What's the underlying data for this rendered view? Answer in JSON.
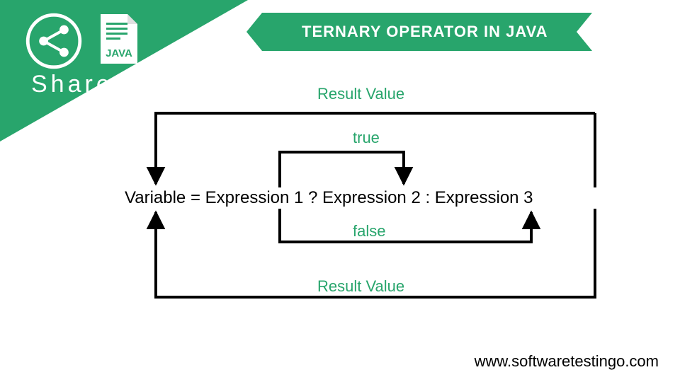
{
  "header": {
    "share_label": "Share",
    "java_badge": "JAVA",
    "title": "TERNARY OPERATOR IN JAVA"
  },
  "diagram": {
    "expression": "Variable = Expression 1 ? Expression 2 : Expression 3",
    "labels": {
      "result_top": "Result Value",
      "true": "true",
      "false": "false",
      "result_bottom": "Result Value"
    }
  },
  "footer": {
    "url": "www.softwaretestingo.com"
  },
  "colors": {
    "brand": "#28a56c"
  }
}
